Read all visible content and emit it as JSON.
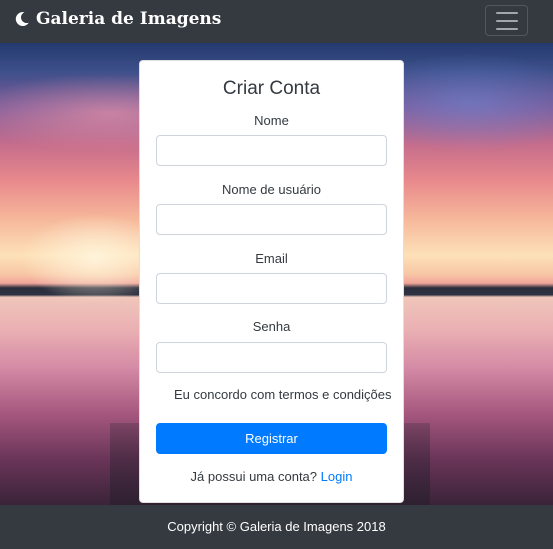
{
  "navbar": {
    "brand": "Galeria de Imagens",
    "brand_icon": "moon-icon",
    "toggler_icon": "hamburger-icon"
  },
  "form": {
    "title": "Criar Conta",
    "fields": [
      {
        "label": "Nome",
        "value": "",
        "placeholder": ""
      },
      {
        "label": "Nome de usuário",
        "value": "",
        "placeholder": ""
      },
      {
        "label": "Email",
        "value": "",
        "placeholder": ""
      },
      {
        "label": "Senha",
        "value": "",
        "placeholder": ""
      }
    ],
    "terms": "Eu concordo com termos e condições",
    "submit": "Registrar",
    "login_prompt": "Já possui uma conta?",
    "login_link": "Login"
  },
  "footer": {
    "copyright": "Copyright © Galeria de Imagens 2018"
  },
  "colors": {
    "navbar_bg": "#343a40",
    "accent": "#007bff"
  }
}
